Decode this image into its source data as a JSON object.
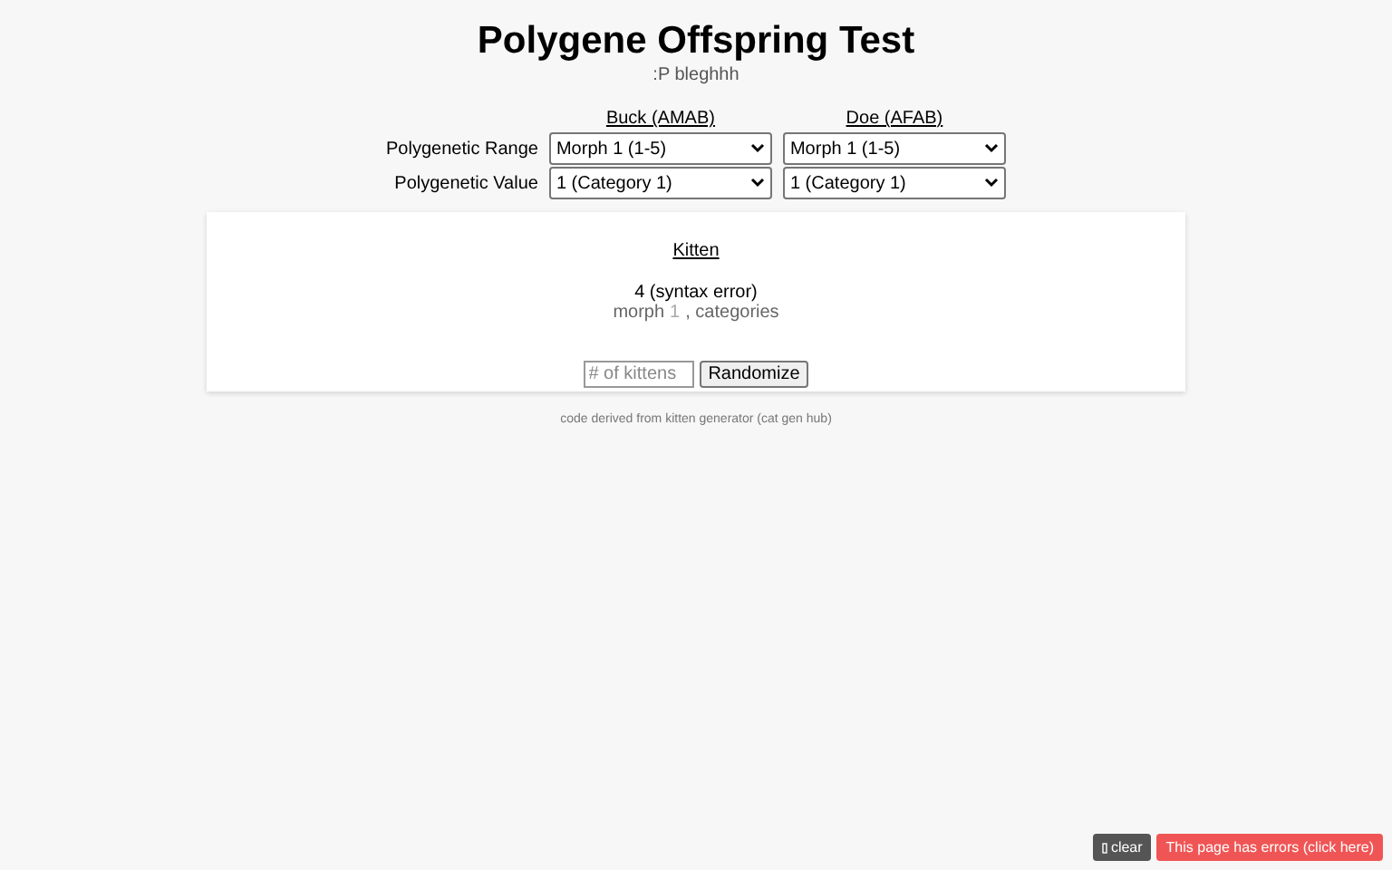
{
  "title": "Polygene Offspring Test",
  "subtitle": ":P bleghhh",
  "parents": [
    {
      "heading": "Buck (AMAB)"
    },
    {
      "heading": "Doe (AFAB)"
    }
  ],
  "rows": [
    {
      "label": "Polygenetic Range",
      "values": [
        "Morph 1 (1-5)",
        "Morph 1 (1-5)"
      ]
    },
    {
      "label": "Polygenetic Value",
      "values": [
        "1 (Category 1)",
        "1 (Category 1)"
      ]
    }
  ],
  "result": {
    "heading": "Kitten",
    "value": "4 (syntax error)",
    "morph_prefix": "morph",
    "morph_number": "1",
    "morph_suffix": ", categories"
  },
  "kittens_field": {
    "placeholder": "# of kittens"
  },
  "randomize_button": "Randomize",
  "footer": "code derived from kitten generator (cat gen hub)",
  "clear_button": "clear",
  "error_button": "This page has errors (click here)"
}
